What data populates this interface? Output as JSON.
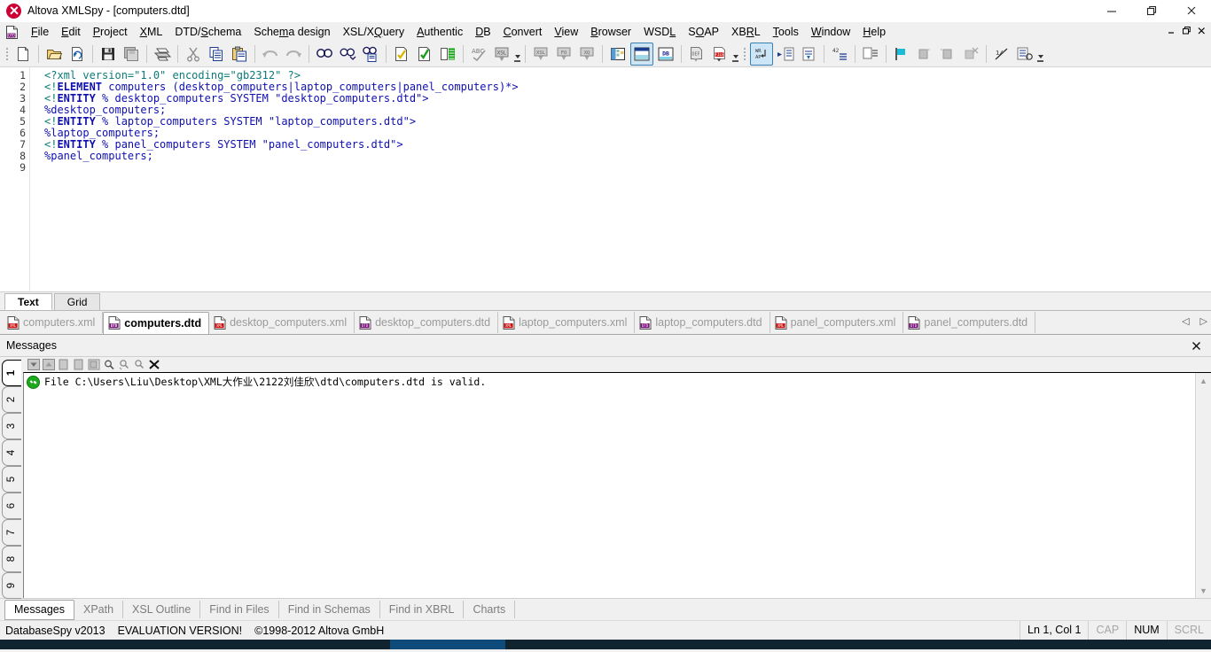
{
  "window": {
    "title": "Altova XMLSpy - [computers.dtd]",
    "app_icon": "xmlspy-logo-icon",
    "minimize": "minimize-icon",
    "maximize": "restore-icon",
    "close": "close-icon"
  },
  "menubar": {
    "app_icon": "dtd-document-icon",
    "items": [
      {
        "label": "File"
      },
      {
        "label": "Edit"
      },
      {
        "label": "Project"
      },
      {
        "label": "XML"
      },
      {
        "label": "DTD/Schema"
      },
      {
        "label": "Schema design"
      },
      {
        "label": "XSL/XQuery"
      },
      {
        "label": "Authentic"
      },
      {
        "label": "DB"
      },
      {
        "label": "Convert"
      },
      {
        "label": "View"
      },
      {
        "label": "Browser"
      },
      {
        "label": "WSDL"
      },
      {
        "label": "SOAP"
      },
      {
        "label": "XBRL"
      },
      {
        "label": "Tools"
      },
      {
        "label": "Window"
      },
      {
        "label": "Help"
      }
    ],
    "mdi_minimize": "mdi-minimize-icon",
    "mdi_restore": "mdi-restore-icon",
    "mdi_close": "mdi-close-icon"
  },
  "toolbar": {
    "groups": [
      [
        "new-file-icon"
      ],
      [
        "open-folder-icon",
        "reload-file-icon"
      ],
      [
        "save-icon",
        "save-all-icon"
      ],
      [
        "print-icon"
      ],
      [
        "cut-icon",
        "copy-icon",
        "paste-icon"
      ],
      [
        "undo-icon",
        "redo-icon"
      ],
      [
        "find-icon",
        "find-next-icon",
        "find-in-files-icon"
      ],
      [
        "check-well-formed-icon",
        "validate-icon",
        "assign-dtd-icon"
      ],
      [
        "spell-check-icon"
      ],
      [
        "xsl-transform-icon"
      ],
      [
        "xsl-icon",
        "fo-icon",
        "xquery-icon"
      ],
      [
        "schema-view-icon",
        "text-view-icon",
        "db-view-icon"
      ],
      [
        "def-file-icon",
        "file-icon"
      ],
      [
        "word-wrap-icon",
        "indent-icon",
        "align-icon"
      ],
      [
        "line-numbers-icon"
      ],
      [
        "bookmark-icon"
      ],
      [
        "flag-icon",
        "prev-bookmark-icon",
        "next-bookmark-icon",
        "clear-bookmark-icon"
      ],
      [
        "toggle-icon",
        "settings-icon"
      ]
    ]
  },
  "editor": {
    "line_numbers": [
      "1",
      "2",
      "3",
      "4",
      "5",
      "6",
      "7",
      "8",
      "9"
    ],
    "lines": [
      {
        "n": 1,
        "text": "<?xml version=\"1.0\" encoding=\"gb2312\" ?>"
      },
      {
        "n": 2,
        "text": "<!ELEMENT computers (desktop_computers|laptop_computers|panel_computers)*>"
      },
      {
        "n": 3,
        "text": "<!ENTITY % desktop_computers SYSTEM \"desktop_computers.dtd\">"
      },
      {
        "n": 4,
        "text": "%desktop_computers;"
      },
      {
        "n": 5,
        "text": "<!ENTITY % laptop_computers SYSTEM \"laptop_computers.dtd\">"
      },
      {
        "n": 6,
        "text": "%laptop_computers;"
      },
      {
        "n": 7,
        "text": "<!ENTITY % panel_computers SYSTEM \"panel_computers.dtd\">"
      },
      {
        "n": 8,
        "text": "%panel_computers;"
      },
      {
        "n": 9,
        "text": ""
      }
    ],
    "colors": {
      "declaration": "#0b7b78",
      "keyword": "#0f0fb0",
      "string": "#0f0fb0",
      "background": "#ffffff"
    }
  },
  "view_tabs": {
    "items": [
      {
        "label": "Text",
        "active": true
      },
      {
        "label": "Grid",
        "active": false
      }
    ]
  },
  "file_tabs": {
    "items": [
      {
        "label": "computers.xml",
        "icon": "xml-file-icon",
        "active": false
      },
      {
        "label": "computers.dtd",
        "icon": "dtd-file-icon",
        "active": true
      },
      {
        "label": "desktop_computers.xml",
        "icon": "xml-file-icon",
        "active": false
      },
      {
        "label": "desktop_computers.dtd",
        "icon": "dtd-file-icon",
        "active": false
      },
      {
        "label": "laptop_computers.xml",
        "icon": "xml-file-icon",
        "active": false
      },
      {
        "label": "laptop_computers.dtd",
        "icon": "dtd-file-icon",
        "active": false
      },
      {
        "label": "panel_computers.xml",
        "icon": "xml-file-icon",
        "active": false
      },
      {
        "label": "panel_computers.dtd",
        "icon": "dtd-file-icon",
        "active": false
      }
    ],
    "prev_icon": "tab-prev-icon",
    "next_icon": "tab-next-icon"
  },
  "messages": {
    "title": "Messages",
    "close_icon": "close-icon",
    "toolbar_icons": [
      "next-message-icon",
      "prev-message-icon",
      "copy-message-icon",
      "copy-all-messages-icon",
      "copy-with-children-icon",
      "find-icon",
      "find-previous-icon",
      "find-next-icon",
      "clear-messages-icon"
    ],
    "numbered_tabs": [
      "1",
      "2",
      "3",
      "4",
      "5",
      "6",
      "7",
      "8",
      "9"
    ],
    "active_tab": "1",
    "entries": [
      {
        "status": "valid",
        "status_icon": "success-check-icon",
        "text": "File C:\\Users\\Liu\\Desktop\\XML大作业\\2122刘佳欣\\dtd\\computers.dtd is valid."
      }
    ],
    "scroll_up_icon": "scroll-up-icon",
    "scroll_down_icon": "scroll-down-icon"
  },
  "bottom_tabs": {
    "items": [
      {
        "label": "Messages",
        "active": true
      },
      {
        "label": "XPath",
        "active": false
      },
      {
        "label": "XSL Outline",
        "active": false
      },
      {
        "label": "Find in Files",
        "active": false
      },
      {
        "label": "Find in Schemas",
        "active": false
      },
      {
        "label": "Find in XBRL",
        "active": false
      },
      {
        "label": "Charts",
        "active": false
      }
    ]
  },
  "statusbar": {
    "product": "DatabaseSpy v2013",
    "evaluation": "EVALUATION VERSION!",
    "copyright": "©1998-2012 Altova GmbH",
    "position": "Ln 1, Col 1",
    "cap": "CAP",
    "num": "NUM",
    "scrl": "SCRL"
  }
}
